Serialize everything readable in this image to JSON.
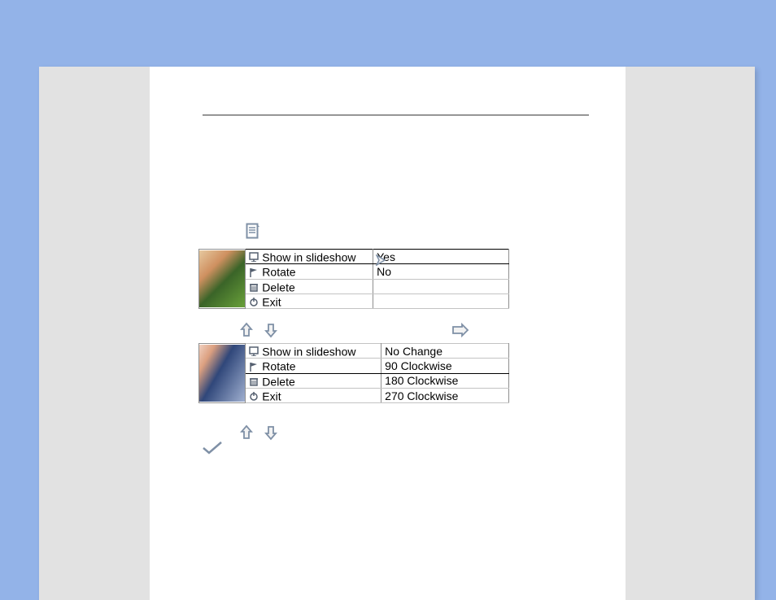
{
  "colors": {
    "background": "#93B3E8",
    "page_bg": "#E2E2E2",
    "paper_bg": "#FFFFFF",
    "icon_stroke": "#7F90A6"
  },
  "menu1": {
    "items": [
      {
        "icon": "slideshow-icon",
        "label": "Show in slideshow"
      },
      {
        "icon": "flag-icon",
        "label": "Rotate"
      },
      {
        "icon": "trash-icon",
        "label": "Delete"
      },
      {
        "icon": "power-icon",
        "label": "Exit"
      }
    ],
    "options": {
      "0": "Yes",
      "1": "No"
    },
    "highlighted_row": 0
  },
  "menu2": {
    "items": [
      {
        "icon": "slideshow-icon",
        "label": "Show in slideshow"
      },
      {
        "icon": "flag-icon",
        "label": "Rotate"
      },
      {
        "icon": "trash-icon",
        "label": "Delete"
      },
      {
        "icon": "power-icon",
        "label": "Exit"
      }
    ],
    "options": {
      "0": "No Change",
      "1": "90 Clockwise",
      "2": "180 Clockwise",
      "3": "270 Clockwise"
    },
    "highlighted_row": 1
  }
}
